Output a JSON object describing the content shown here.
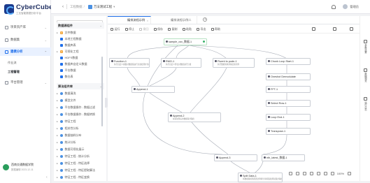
{
  "brand": {
    "name": "CyberCube",
    "subtitle": "工业智能数据分析平台"
  },
  "nav": {
    "items": [
      {
        "label": "项目资产库"
      },
      {
        "label": "数据集"
      },
      {
        "label": "建模分析"
      },
      {
        "label": "平台管理"
      }
    ],
    "sub_items": [
      {
        "label": "作业流"
      },
      {
        "label": "工程管理"
      }
    ],
    "footer": {
      "org": "西南交通数据学院",
      "meta": "数据编辑  2023-12-11"
    }
  },
  "topbar": {
    "back": "‹",
    "crumb_root": "工程数据",
    "crumb_current": "万法测试工程",
    "user": "管理员"
  },
  "panel": {
    "search_placeholder": "",
    "section1": {
      "title": "数据源组件",
      "action": "⌄"
    },
    "section1_items": [
      {
        "label": "文件数据"
      },
      {
        "label": "本地工程数据",
        "arrow": "▾"
      },
      {
        "label": "数据库表"
      },
      {
        "label": "平台数据"
      },
      {
        "label": "可视化工程",
        "arrow": "▾"
      },
      {
        "label": "HDFS数据"
      },
      {
        "label": "数据库自定义数据"
      },
      {
        "label": "数仓表"
      },
      {
        "label": "文件数据源"
      }
    ],
    "section2": {
      "title": "算法组件库",
      "action": "⌄"
    },
    "section2_items": [
      {
        "label": "数据清洗"
      },
      {
        "label": "模型文件"
      },
      {
        "label": "平台数据操作 - 数据过滤"
      },
      {
        "label": "平台数据操作 - 数据转换"
      },
      {
        "label": "特征工程"
      },
      {
        "label": "相关性分析"
      },
      {
        "label": "数据抽样分布"
      },
      {
        "label": "统计分析"
      },
      {
        "label": "数据可视化展示"
      },
      {
        "label": "特征工程 - 统计分析"
      },
      {
        "label": "特征工程 - 特征选择"
      },
      {
        "label": "特征工程 - 特征提取算法"
      },
      {
        "label": "特征工程 - 特征变换"
      }
    ]
  },
  "tabs": [
    {
      "label": "编排流程示例",
      "close": "×"
    },
    {
      "label": "编排流程示例二"
    }
  ],
  "tab_add": "+",
  "toolbar": {
    "left": [
      {
        "label": "运行",
        "disabled": false
      },
      {
        "label": "停止",
        "disabled": false
      },
      {
        "label": "撤回",
        "disabled": true
      },
      {
        "label": "保存",
        "disabled": false
      },
      {
        "label": "复制",
        "disabled": false
      },
      {
        "label": "粘贴",
        "disabled": false
      },
      {
        "label": "导出",
        "disabled": false
      },
      {
        "label": "帮助",
        "disabled": false
      }
    ]
  },
  "nodes": [
    {
      "id": "n1",
      "label": "sample_csv_数据-1",
      "sub": "",
      "ok": true
    },
    {
      "id": "n2",
      "label": "Function-1",
      "sub": "执行自定义函数对数据集进行过滤处理并生成新数据",
      "ok": false
    },
    {
      "id": "n3",
      "label": "RMO-1",
      "sub": "执行自定义算法对数据进行分组",
      "ok": false
    },
    {
      "id": "n4",
      "label": "Fluent to pode-1",
      "sub": "执行数据转换并输出新的列",
      "ok": false
    },
    {
      "id": "n5",
      "label": "Chunk Loop Start-1",
      "sub": "",
      "ok": false
    },
    {
      "id": "n6",
      "label": "Oneshot Demodulate",
      "sub": "",
      "ok": false
    },
    {
      "id": "n7",
      "label": "Append-1",
      "sub": "",
      "ok": false
    },
    {
      "id": "n8",
      "label": "FFT-1",
      "sub": "",
      "ok": false
    },
    {
      "id": "n9",
      "label": "Append-2",
      "sub": "拼接处理后的数据集并输出",
      "ok": false
    },
    {
      "id": "n10",
      "label": "Select Row-1",
      "sub": "",
      "ok": false
    },
    {
      "id": "n11",
      "label": "Loop End-1",
      "sub": "",
      "ok": false
    },
    {
      "id": "n12",
      "label": "Transpose-1",
      "sub": "",
      "ok": false
    },
    {
      "id": "n13",
      "label": "Append-3",
      "sub": "",
      "ok": false
    },
    {
      "id": "n14",
      "label": "nth_latest_数据-1",
      "sub": "",
      "ok": false
    },
    {
      "id": "n15",
      "label": "Split Data-1",
      "sub": "将数据集按照配置比例拆分训练集和测试集并输出",
      "ok": false
    }
  ],
  "zoom": {
    "value": "100%"
  },
  "rail": [
    {
      "label": "参数设置"
    },
    {
      "label": "数据预览"
    },
    {
      "label": "运行日志"
    }
  ]
}
